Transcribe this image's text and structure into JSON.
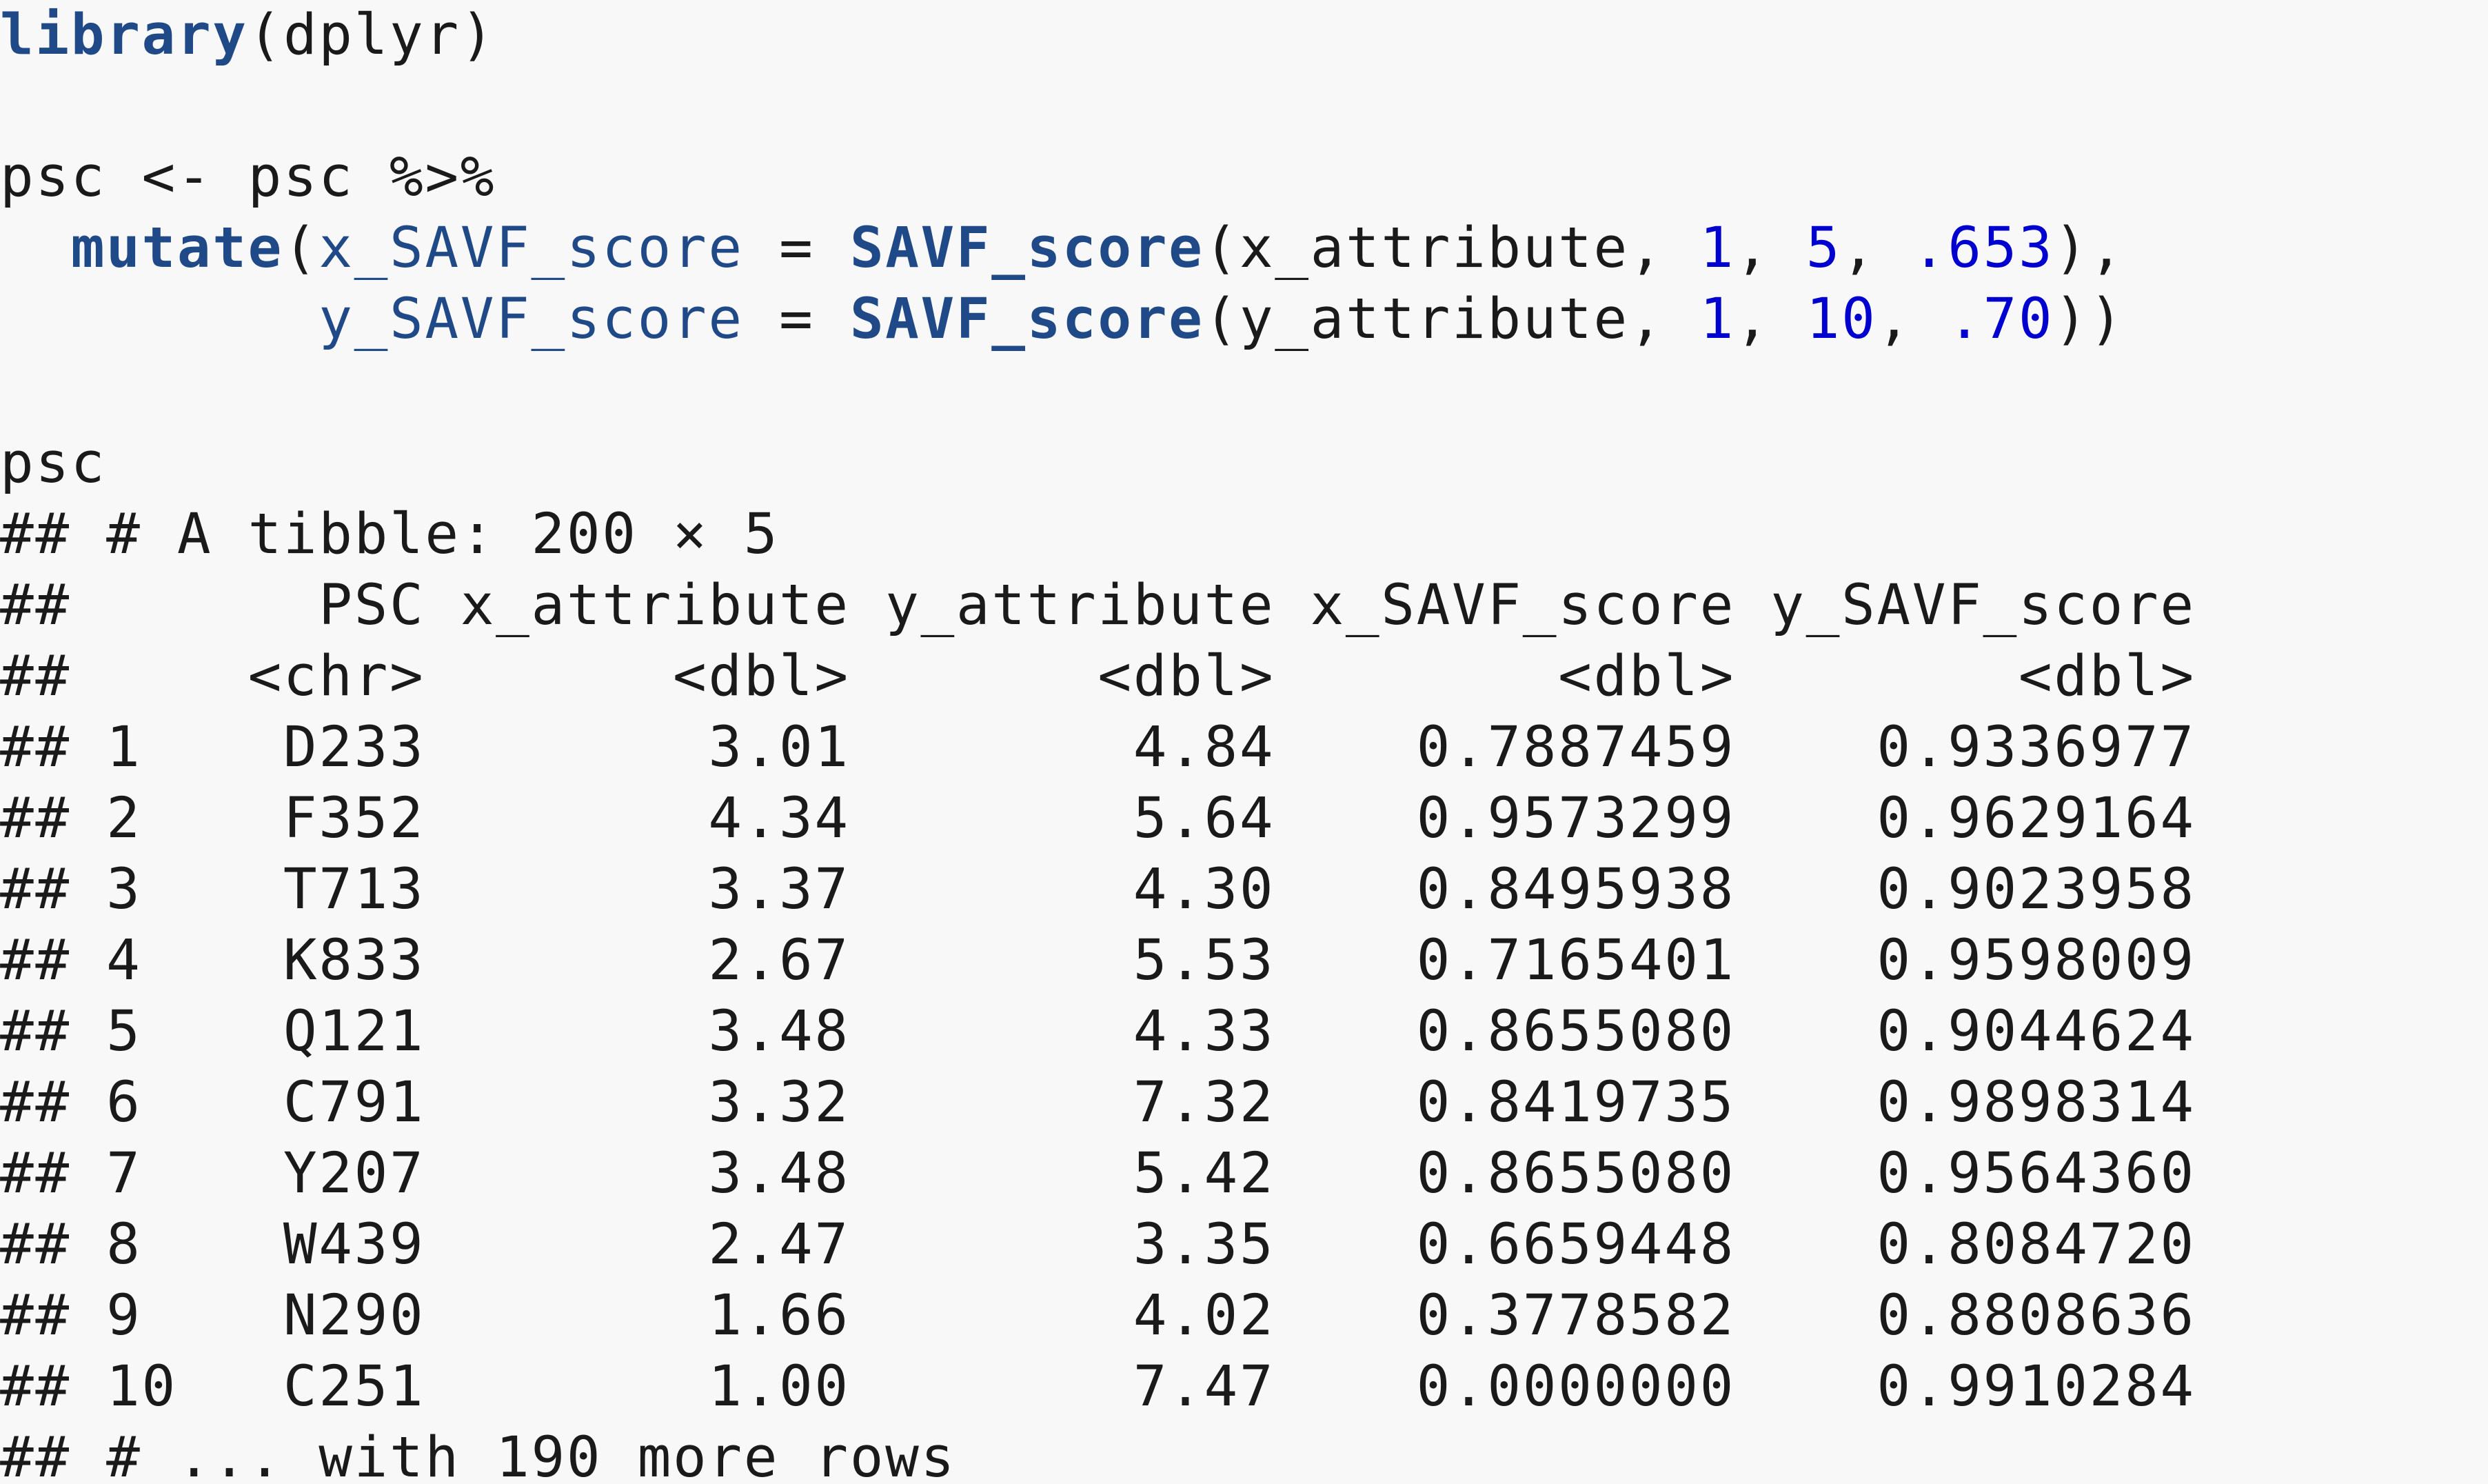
{
  "code": {
    "line1": {
      "fn": "library",
      "arg": "(dplyr)"
    },
    "line2": "psc <- psc %>%",
    "line3": {
      "indent": "  ",
      "fn": "mutate",
      "open": "(",
      "var": "x_SAVF_score",
      "eq": " = ",
      "call": "SAVF_score",
      "args_pre": "(x_attribute, ",
      "n1": "1",
      "sep1": ", ",
      "n2": "5",
      "sep2": ", ",
      "n3": ".653",
      "close": "),"
    },
    "line4": {
      "indent": "         ",
      "var": "y_SAVF_score",
      "eq": " = ",
      "call": "SAVF_score",
      "args_pre": "(y_attribute, ",
      "n1": "1",
      "sep1": ", ",
      "n2": "10",
      "sep2": ", ",
      "n3": ".70",
      "close": "))"
    }
  },
  "output": {
    "command": "psc",
    "tibble_line": "## # A tibble: 200 × 5",
    "header_line": "##       PSC x_attribute y_attribute x_SAVF_score y_SAVF_score",
    "types_line": "##     <chr>       <dbl>       <dbl>        <dbl>        <dbl>",
    "rows": [
      "## 1    D233        3.01        4.84    0.7887459    0.9336977",
      "## 2    F352        4.34        5.64    0.9573299    0.9629164",
      "## 3    T713        3.37        4.30    0.8495938    0.9023958",
      "## 4    K833        2.67        5.53    0.7165401    0.9598009",
      "## 5    Q121        3.48        4.33    0.8655080    0.9044624",
      "## 6    C791        3.32        7.32    0.8419735    0.9898314",
      "## 7    Y207        3.48        5.42    0.8655080    0.9564360",
      "## 8    W439        2.47        3.35    0.6659448    0.8084720",
      "## 9    N290        1.66        4.02    0.3778582    0.8808636",
      "## 10   C251        1.00        7.47    0.0000000    0.9910284"
    ],
    "footer": "## # ... with 190 more rows"
  }
}
